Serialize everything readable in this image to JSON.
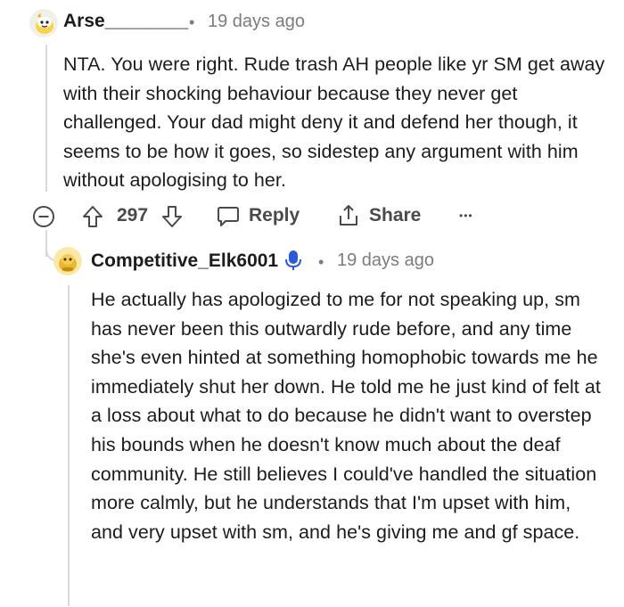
{
  "comment": {
    "author": "Arse________",
    "timestamp": "19 days ago",
    "body": "NTA. You were right. Rude trash AH people like yr SM get away with their shocking behaviour because they never get challenged. Your dad might deny it and defend her though, it seems to be how it goes, so sidestep any argument with him without apologising to her.",
    "votes": "297",
    "reply_label": "Reply",
    "share_label": "Share",
    "more_label": "•••"
  },
  "reply": {
    "author": "Competitive_Elk6001",
    "timestamp": "19 days ago",
    "body": "He actually has apologized to me for not speaking up, sm has never been this outwardly rude before, and any time she's even hinted at something homophobic towards me he immediately shut her down. He told me he just kind of felt at a loss about what to do because he didn't want to overstep his bounds when he doesn't know much about the deaf community. He still believes I could've handled the situation more calmly, but he understands that I'm upset with him, and very upset with sm, and he's giving me and gf space."
  },
  "separator": "•",
  "colors": {
    "text": "#1c1c1c",
    "meta": "#7c7c7c",
    "thread_line": "#d7dadc",
    "action": "#4a4a4a",
    "mic_badge": "#2a5bd7"
  },
  "icons": [
    "snoo-avatar-icon",
    "collapse-icon",
    "upvote-icon",
    "downvote-icon",
    "reply-bubble-icon",
    "share-icon",
    "microphone-icon"
  ]
}
